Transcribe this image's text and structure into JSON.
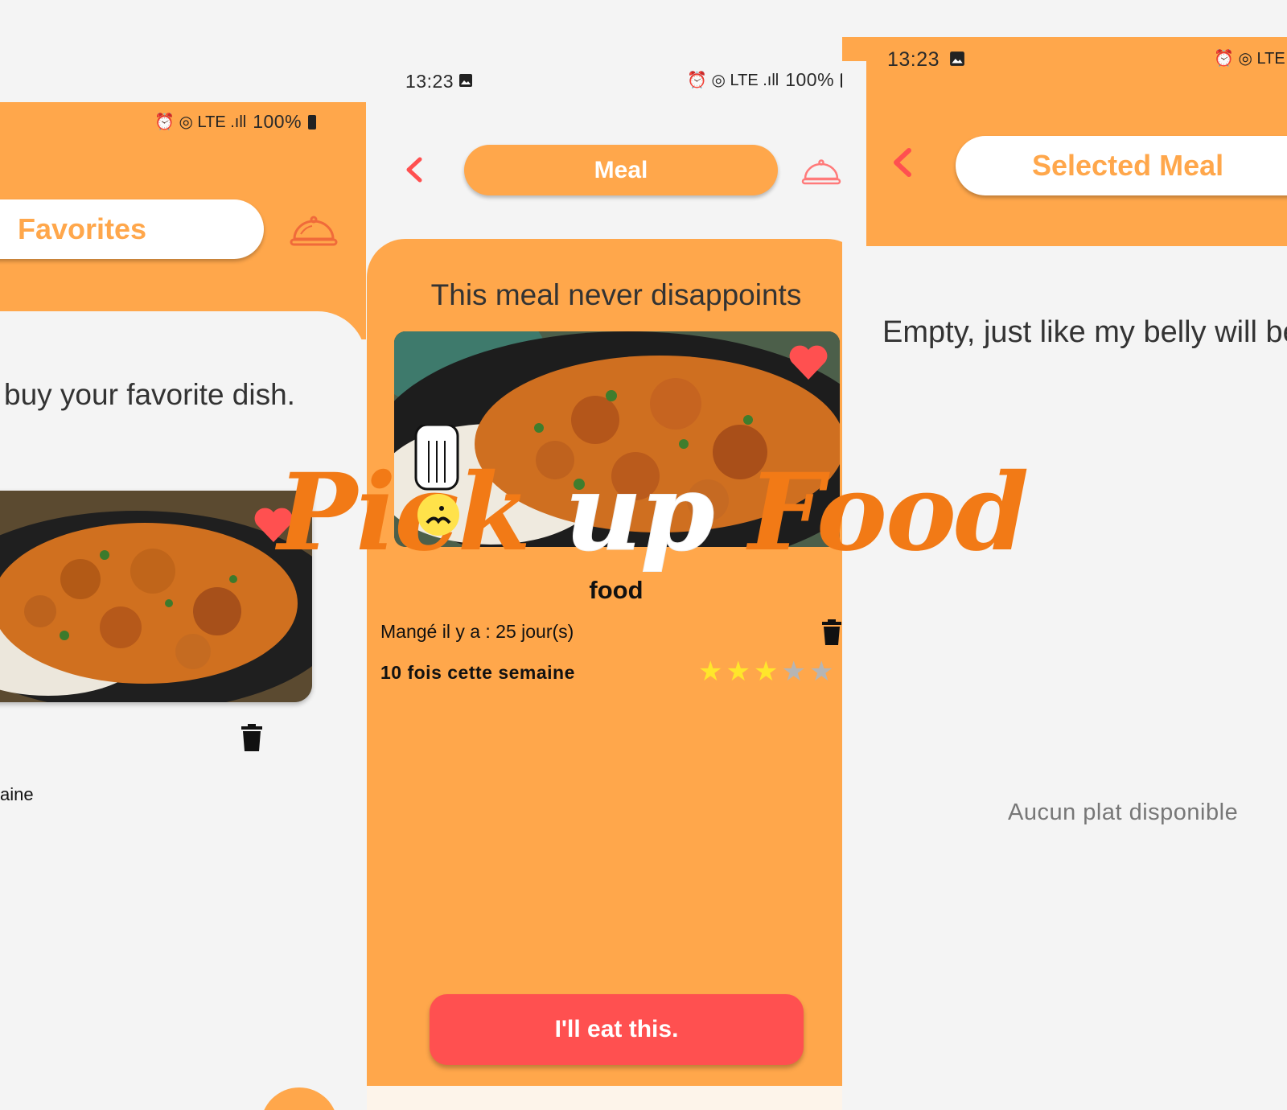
{
  "colors": {
    "accent": "#ffa74b",
    "heart": "#ff5050",
    "button": "#ff5050",
    "star_on": "#ffe62b",
    "star_off": "#b5b5b5"
  },
  "left_screen": {
    "status": {
      "icons_text": "⏰ ◎ LTE .ıll",
      "battery": "100%"
    },
    "title": "Favorites",
    "subtitle": "buy your favorite dish.",
    "caption": "aine",
    "icons": [
      "cloche-icon",
      "heart-icon",
      "trash-icon"
    ]
  },
  "mid_screen": {
    "status": {
      "time": "13:23",
      "icons_text": "⏰ ◎ LTE .ıll",
      "battery": "100%"
    },
    "title": "Meal",
    "headline": "This meal never disappoints",
    "meal_name": "food",
    "eaten_ago": "Mangé il y a : 25 jour(s)",
    "times_week": "10 fois cette semaine",
    "rating": 3,
    "rating_max": 5,
    "button_label": "I'll eat this.",
    "icons": [
      "back-icon",
      "cloche-icon",
      "heart-icon",
      "trash-icon"
    ]
  },
  "right_screen": {
    "status": {
      "time": "13:23",
      "icons_text": "⏰ ◎ LTE"
    },
    "title": "Selected Meal",
    "headline": "Empty, just like my belly will be",
    "empty_text": "Aucun plat disponible",
    "icons": [
      "back-icon"
    ]
  },
  "logo": {
    "word1": "Pick",
    "word2": "up",
    "word3": "Food"
  }
}
